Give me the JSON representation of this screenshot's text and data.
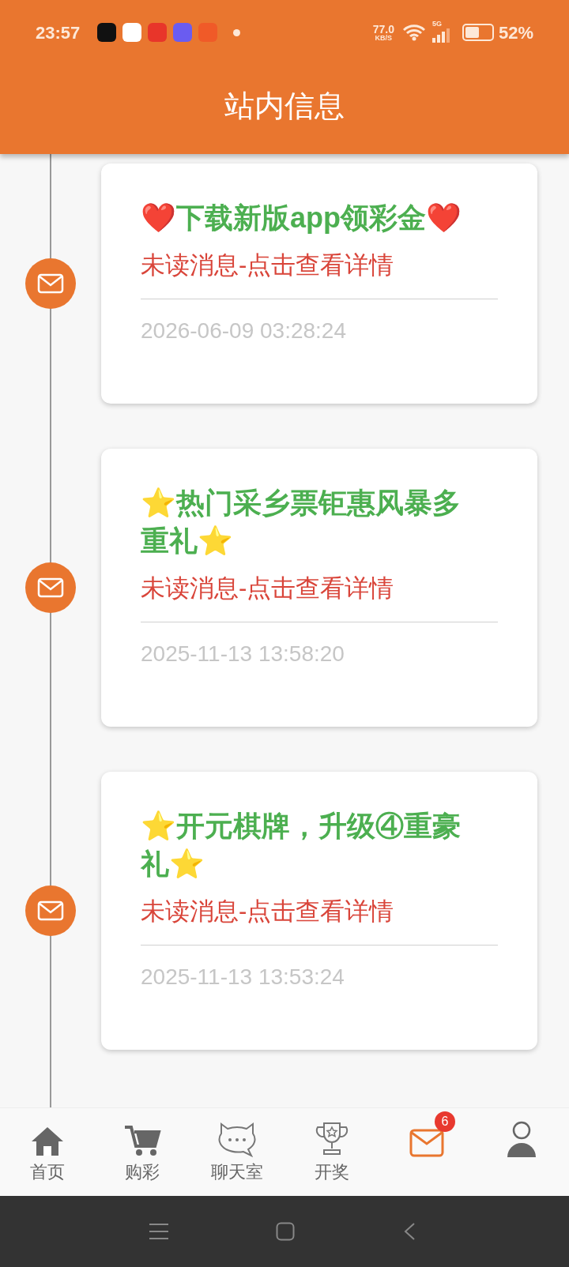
{
  "status_bar": {
    "time": "23:57",
    "speed_value": "77.0",
    "speed_unit": "KB/S",
    "network": "5G",
    "battery": "52%"
  },
  "header": {
    "title": "站内信息"
  },
  "messages": [
    {
      "title": "❤️下载新版app领彩金❤️",
      "status": "未读消息-点击查看详情",
      "date": "2026-06-09 03:28:24"
    },
    {
      "title": "⭐热门采乡票钜惠风暴多重礼⭐",
      "status": "未读消息-点击查看详情",
      "date": "2025-11-13 13:58:20"
    },
    {
      "title": "⭐开元棋牌，升级④重豪礼⭐",
      "status": "未读消息-点击查看详情",
      "date": "2025-11-13 13:53:24"
    }
  ],
  "nav": [
    {
      "kind": "home",
      "label": "首页",
      "selected": false
    },
    {
      "kind": "cart",
      "label": "购彩",
      "selected": false
    },
    {
      "kind": "chat",
      "label": "聊天室",
      "selected": false
    },
    {
      "kind": "trophy",
      "label": "开奖",
      "selected": false
    },
    {
      "kind": "mail",
      "selected": true,
      "badge": "6"
    },
    {
      "kind": "user",
      "selected": false
    }
  ]
}
